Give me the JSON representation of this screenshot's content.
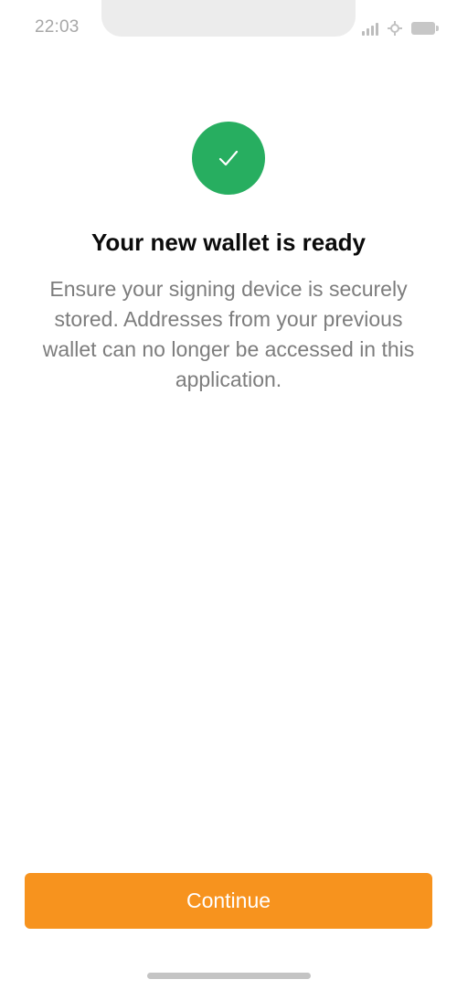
{
  "status_bar": {
    "time": "22:03",
    "icons": [
      "signal-icon",
      "wifi-icon",
      "battery-icon"
    ]
  },
  "main": {
    "icon": "checkmark-icon",
    "title": "Your new wallet is ready",
    "description": "Ensure your signing device is securely stored. Addresses from your previous wallet can no longer be accessed in this application."
  },
  "actions": {
    "continue_label": "Continue"
  },
  "colors": {
    "success": "#27ae60",
    "accent": "#f7931e",
    "title_text": "#0b0b0b",
    "body_text": "#7d7d7d"
  }
}
